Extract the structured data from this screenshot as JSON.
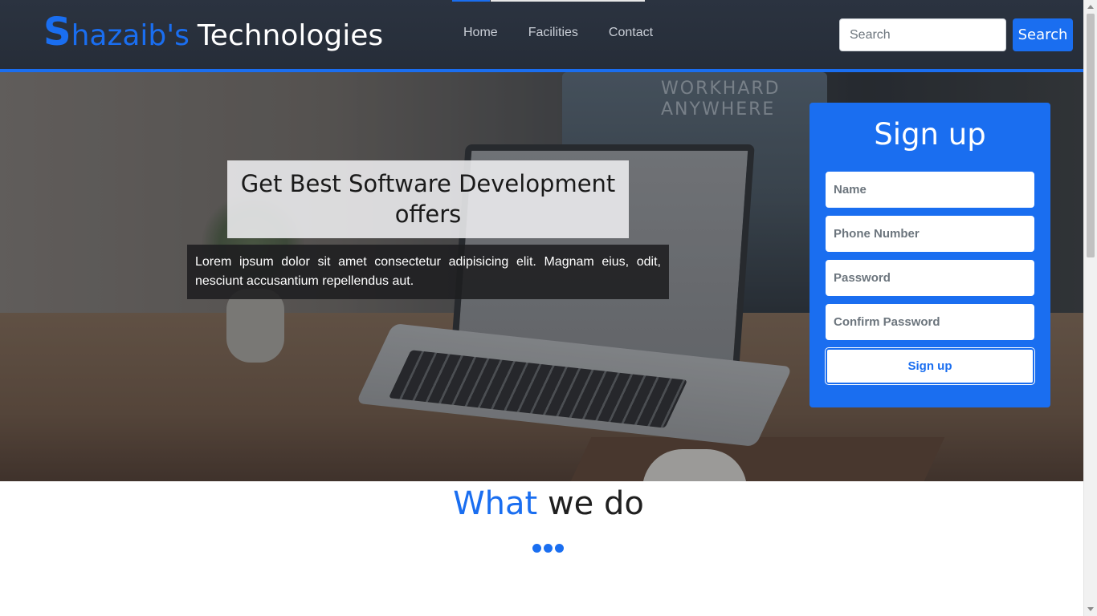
{
  "brand": {
    "initial": "S",
    "rest": "hazaib's",
    "suffix": "Technologies"
  },
  "nav": {
    "links": [
      "Home",
      "Facilities",
      "Contact"
    ],
    "search_placeholder": "Search",
    "search_button": "Search"
  },
  "hero": {
    "title": "Get Best Software Development offers",
    "description": "Lorem ipsum dolor sit amet consectetur adipisicing elit. Magnam eius, odit, nesciunt accusantium repellendus aut.",
    "monitor_text": "WORKHARD ANYWHERE"
  },
  "signup": {
    "title": "Sign up",
    "name_placeholder": "Name",
    "phone_placeholder": "Phone Number",
    "password_placeholder": "Password",
    "confirm_placeholder": "Confirm Password",
    "button": "Sign up"
  },
  "what_we_do": {
    "highlight": "What",
    "rest": " we do"
  },
  "colors": {
    "accent": "#1a6ef0",
    "navbar": "#2b3340"
  }
}
